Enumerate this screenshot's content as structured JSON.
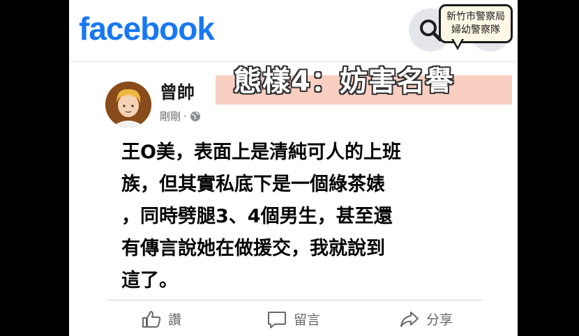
{
  "brand": {
    "logo_text": "facebook",
    "color": "#1877f2"
  },
  "header_icons": {
    "search": "search-icon",
    "menu": "menu-icon"
  },
  "watermark": {
    "line1": "新竹市警察局",
    "line2": "婦幼警察隊"
  },
  "title_banner": {
    "text": "態樣4：妨害名譽",
    "banner_color": "#f9cfc2"
  },
  "post": {
    "author": "曾帥",
    "time": "剛剛",
    "separator": "·",
    "visibility_icon": "globe-icon",
    "body": "王O美，表面上是清純可人的上班\n族，但其實私底下是一個綠茶婊\n，同時劈腿3、4個男生，甚至還\n有傳言說她在做援交，我就說到\n這了。"
  },
  "actions": {
    "like": "讚",
    "comment": "留言",
    "share": "分享"
  }
}
